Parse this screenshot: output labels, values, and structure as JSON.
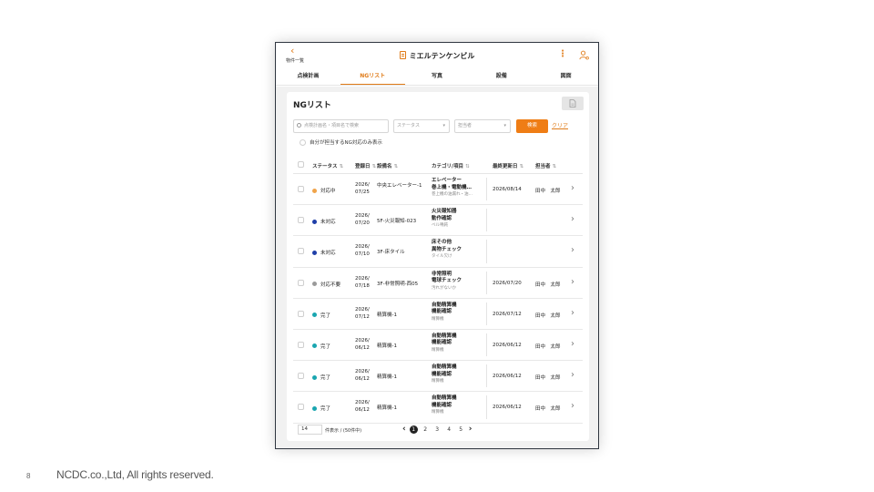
{
  "slide": {
    "number": "8",
    "copyright": "NCDC.co.,Ltd, All rights reserved."
  },
  "app": {
    "back_label": "物件一覧",
    "title": "ミエルテンケンビル",
    "tabs": [
      "点検計画",
      "NGリスト",
      "写真",
      "設備",
      "図面"
    ],
    "active_tab": 1,
    "accent_color": "#ef7d15"
  },
  "ng": {
    "title": "NGリスト",
    "search_placeholder": "点検計画名・項目名で検索",
    "status_select": "ステータス",
    "assignee_select": "担当者",
    "search_button": "検索",
    "clear_link": "クリア",
    "own_filter_label": "自分が担当するNG対応のみ表示",
    "columns": {
      "status": "ステータス",
      "registered": "登録日",
      "equipment": "設備名",
      "category": "カテゴリ/項目",
      "updated": "最終更新日",
      "assignee": "担当者"
    },
    "rows": [
      {
        "status": "対応中",
        "status_color": "#f0a44a",
        "date1": "2026/",
        "date2": "07/25",
        "equip": "中央エレベーター-1",
        "cat1": "エレベーター",
        "cat2": "巻上機・電動機…",
        "note": "巻上機の油漏れ・油…",
        "updated": "2026/08/14",
        "assignee": "田中　太郎"
      },
      {
        "status": "未対応",
        "status_color": "#1f3fa8",
        "date1": "2026/",
        "date2": "07/20",
        "equip": "5F-火災報知-023",
        "cat1": "火災報知器",
        "cat2": "動作確認",
        "note": "ベル鳴鈍",
        "updated": "",
        "assignee": ""
      },
      {
        "status": "未対応",
        "status_color": "#1f3fa8",
        "date1": "2026/",
        "date2": "07/10",
        "equip": "3F-床タイル",
        "cat1": "床その他",
        "cat2": "異物チェック",
        "note": "タイル欠け",
        "updated": "",
        "assignee": ""
      },
      {
        "status": "対応不要",
        "status_color": "#9a9a9a",
        "date1": "2026/",
        "date2": "07/18",
        "equip": "3F-非常照明-西05",
        "cat1": "非常照明",
        "cat2": "電球チェック",
        "note": "汚れがないか",
        "updated": "2026/07/20",
        "assignee": "田中　太郎"
      },
      {
        "status": "完了",
        "status_color": "#1aa6b0",
        "date1": "2026/",
        "date2": "07/12",
        "equip": "精算機-1",
        "cat1": "自動精算機",
        "cat2": "機能確認",
        "note": "精算機",
        "updated": "2026/07/12",
        "assignee": "田中　太郎"
      },
      {
        "status": "完了",
        "status_color": "#1aa6b0",
        "date1": "2026/",
        "date2": "06/12",
        "equip": "精算機-1",
        "cat1": "自動精算機",
        "cat2": "機能確認",
        "note": "精算機",
        "updated": "2026/06/12",
        "assignee": "田中　太郎"
      },
      {
        "status": "完了",
        "status_color": "#1aa6b0",
        "date1": "2026/",
        "date2": "06/12",
        "equip": "精算機-1",
        "cat1": "自動精算機",
        "cat2": "機能確認",
        "note": "精算機",
        "updated": "2026/06/12",
        "assignee": "田中　太郎"
      },
      {
        "status": "完了",
        "status_color": "#1aa6b0",
        "date1": "2026/",
        "date2": "06/12",
        "equip": "精算機-1",
        "cat1": "自動精算機",
        "cat2": "機能確認",
        "note": "精算機",
        "updated": "2026/06/12",
        "assignee": "田中　太郎"
      }
    ],
    "footer": {
      "per_page": "14",
      "count_label": "件表示 / (50件中)",
      "pages": [
        "1",
        "2",
        "3",
        "4",
        "5"
      ],
      "current_page": 1
    }
  }
}
